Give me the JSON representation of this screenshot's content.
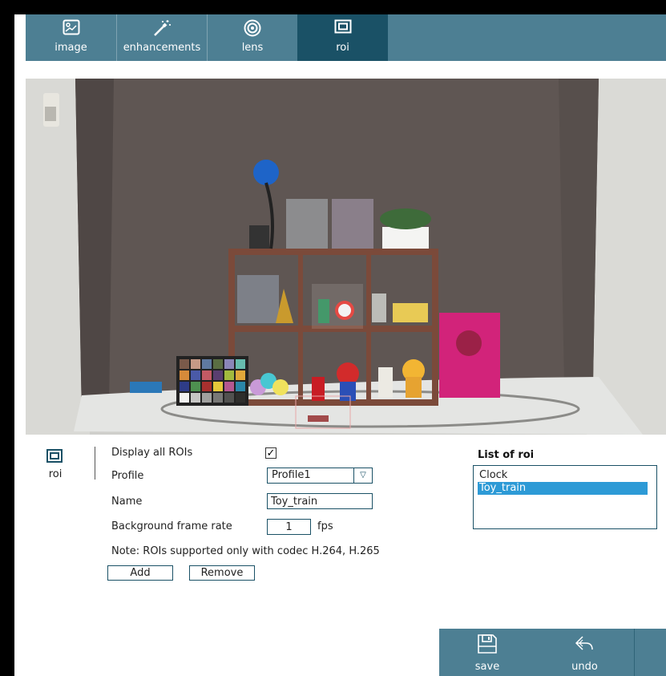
{
  "tabs": [
    {
      "label": "image",
      "icon": "image-icon"
    },
    {
      "label": "enhancements",
      "icon": "magic-wand-icon"
    },
    {
      "label": "lens",
      "icon": "lens-icon"
    },
    {
      "label": "roi",
      "icon": "roi-icon",
      "active": true
    }
  ],
  "side": {
    "label": "roi",
    "icon": "roi-icon"
  },
  "form": {
    "display_all_label": "Display all ROIs",
    "display_all_checked": "✓",
    "profile_label": "Profile",
    "profile_value": "Profile1",
    "name_label": "Name",
    "name_value": "Toy_train",
    "bg_rate_label": "Background frame rate",
    "bg_rate_value": "1",
    "bg_rate_unit": "fps",
    "note": "Note: ROIs supported only with codec H.264, H.265",
    "add_label": "Add",
    "remove_label": "Remove"
  },
  "roi_list": {
    "title": "List of roi",
    "items": [
      {
        "label": "Clock",
        "selected": false
      },
      {
        "label": "Toy_train",
        "selected": true
      }
    ]
  },
  "actions": [
    {
      "label": "save",
      "icon": "save-icon"
    },
    {
      "label": "undo",
      "icon": "undo-icon"
    }
  ],
  "colors": {
    "tabbar": "#4d7f93",
    "tab_active": "#1a5166",
    "selection": "#2d9ad6"
  }
}
